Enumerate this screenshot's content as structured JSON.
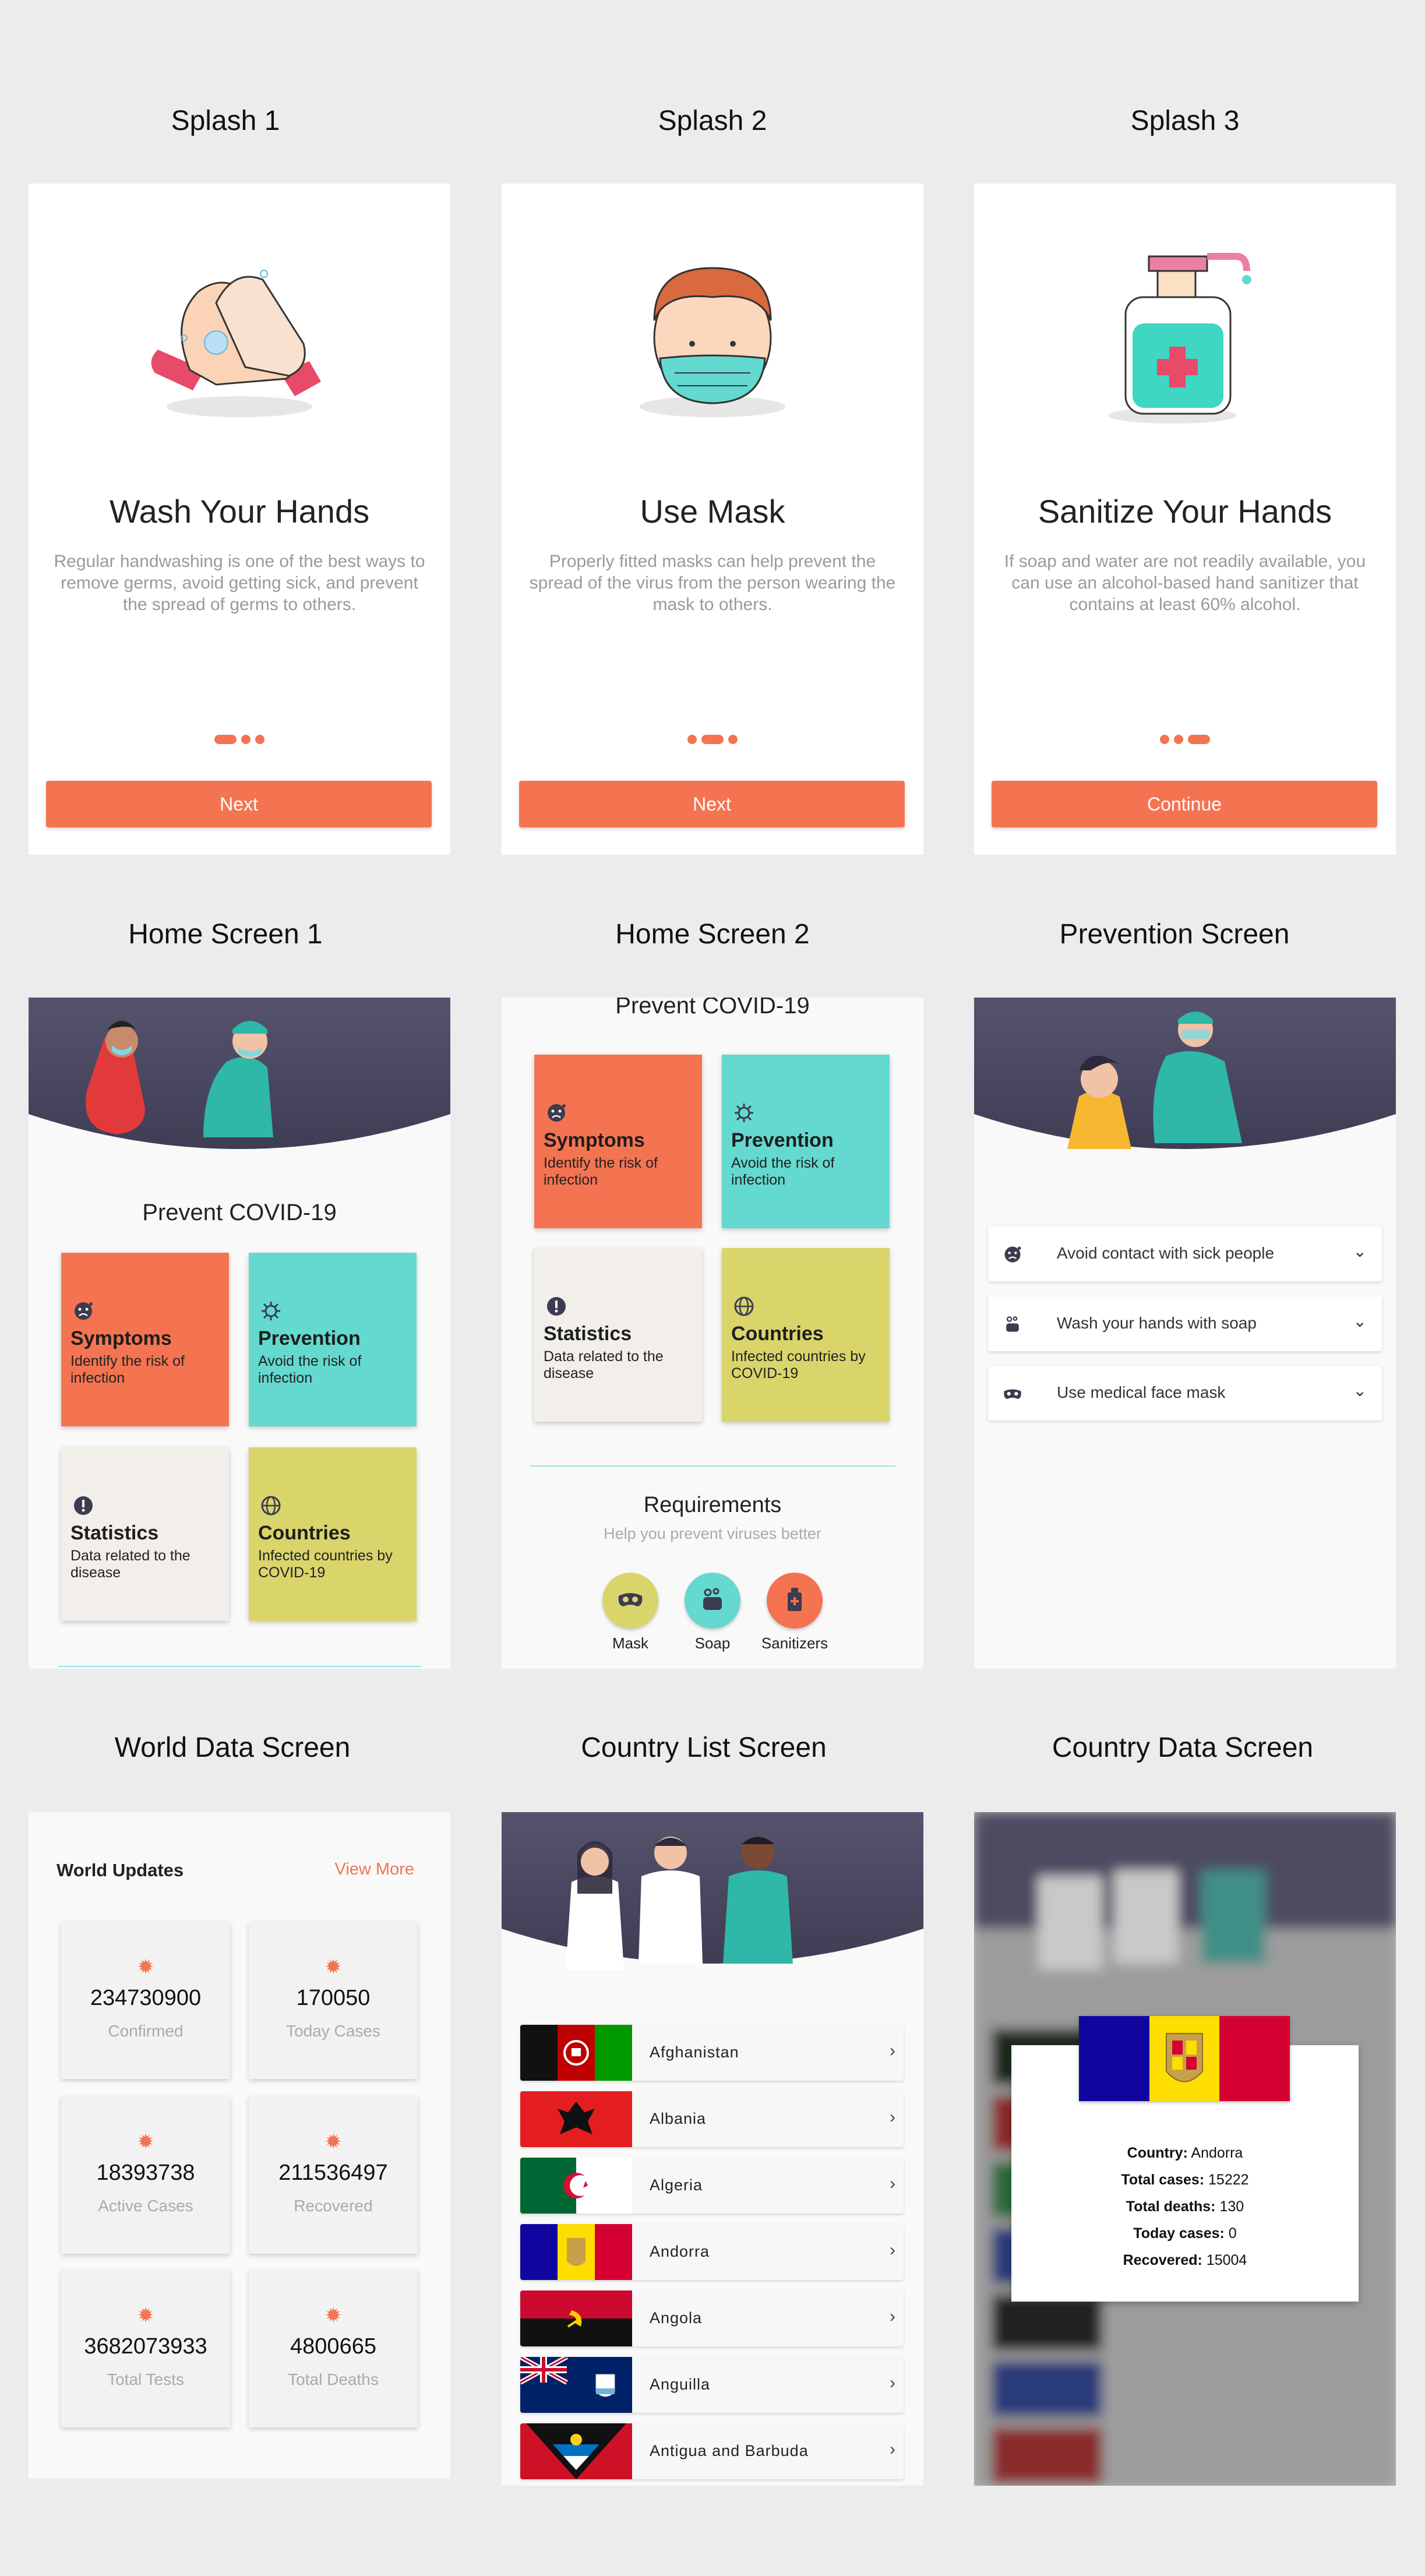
{
  "labels": {
    "splash1": "Splash 1",
    "splash2": "Splash 2",
    "splash3": "Splash 3",
    "home1": "Home Screen 1",
    "home2": "Home Screen 2",
    "prevention": "Prevention Screen",
    "world": "World Data Screen",
    "countries": "Country List Screen",
    "country": "Country Data Screen"
  },
  "splash1": {
    "title": "Wash Your Hands",
    "desc": "Regular handwashing is one of the best ways to remove germs, avoid getting sick, and prevent the spread of germs to others.",
    "button": "Next",
    "active_dot": 1
  },
  "splash2": {
    "title": "Use Mask",
    "desc": "Properly fitted masks can help prevent the spread of the virus from the person wearing the mask to others.",
    "button": "Next",
    "active_dot": 2
  },
  "splash3": {
    "title": "Sanitize Your Hands",
    "desc": "If soap and water are not readily available, you can use an alcohol-based hand sanitizer that contains at least 60% alcohol.",
    "button": "Continue",
    "active_dot": 3
  },
  "home": {
    "heading": "Prevent COVID-19",
    "tiles": [
      {
        "title": "Symptoms",
        "sub": "Identify the risk of infection",
        "icon": "sick-face-icon",
        "color": "#f47451"
      },
      {
        "title": "Prevention",
        "sub": "Avoid the risk of infection",
        "icon": "virus-icon",
        "color": "#63d9d0"
      },
      {
        "title": "Statistics",
        "sub": "Data related to the disease",
        "icon": "alert-icon",
        "color": "#f2efea"
      },
      {
        "title": "Countries",
        "sub": "Infected countries by COVID-19",
        "icon": "globe-icon",
        "color": "#d9d56b"
      }
    ],
    "requirements": {
      "title": "Requirements",
      "sub": "Help you prevent viruses better",
      "items": [
        {
          "label": "Mask",
          "icon": "mask-icon",
          "color": "#d9d56b"
        },
        {
          "label": "Soap",
          "icon": "soap-icon",
          "color": "#63d9d0"
        },
        {
          "label": "Sanitizers",
          "icon": "sanitizer-icon",
          "color": "#f47451"
        }
      ]
    }
  },
  "prevention": {
    "items": [
      {
        "label": "Avoid contact with sick people",
        "icon": "sick-face-icon"
      },
      {
        "label": "Wash your hands with soap",
        "icon": "soap-icon"
      },
      {
        "label": "Use medical face mask",
        "icon": "mask-icon"
      }
    ]
  },
  "world": {
    "title": "World Updates",
    "view_more": "View More",
    "cards": [
      {
        "value": "234730900",
        "label": "Confirmed"
      },
      {
        "value": "170050",
        "label": "Today Cases"
      },
      {
        "value": "18393738",
        "label": "Active Cases"
      },
      {
        "value": "211536497",
        "label": "Recovered"
      },
      {
        "value": "3682073933",
        "label": "Total Tests"
      },
      {
        "value": "4800665",
        "label": "Total Deaths"
      }
    ]
  },
  "countries": [
    "Afghanistan",
    "Albania",
    "Algeria",
    "Andorra",
    "Angola",
    "Anguilla",
    "Antigua and Barbuda"
  ],
  "country_detail": {
    "country_label": "Country:",
    "country": "Andorra",
    "cases_label": "Total cases:",
    "cases": "15222",
    "deaths_label": "Total deaths:",
    "deaths": "130",
    "today_label": "Today cases:",
    "today": "0",
    "recovered_label": "Recovered:",
    "recovered": "15004"
  },
  "colors": {
    "accent": "#f47451",
    "teal": "#63d9d0",
    "olive": "#d9d56b",
    "cream": "#f2efea",
    "hero": "#4a4860"
  }
}
